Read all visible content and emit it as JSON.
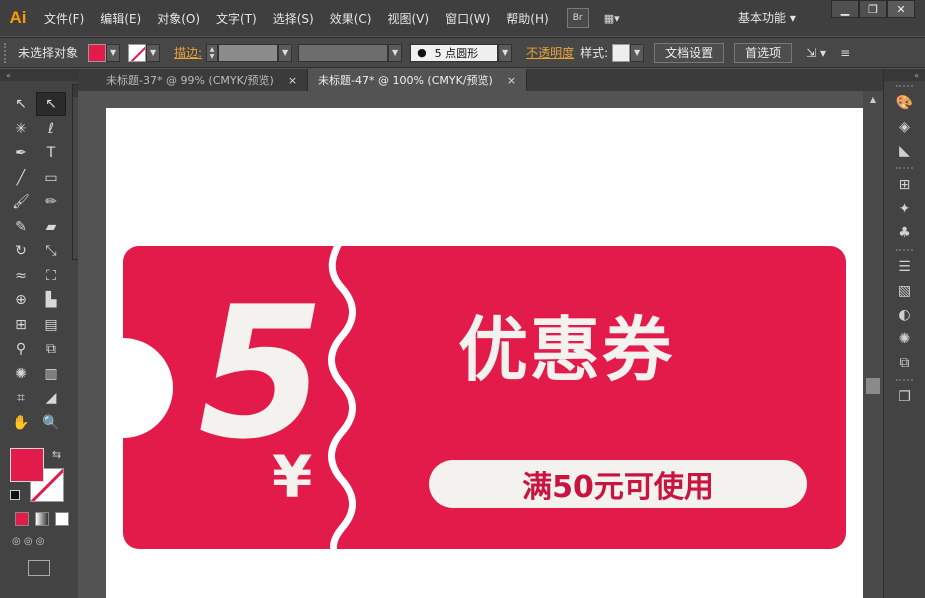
{
  "app": {
    "logo_text": "Ai",
    "menu": [
      "文件(F)",
      "编辑(E)",
      "对象(O)",
      "文字(T)",
      "选择(S)",
      "效果(C)",
      "视图(V)",
      "窗口(W)",
      "帮助(H)"
    ],
    "bridge_button": "Br",
    "workspace_label": "基本功能",
    "window_minimize": "▁",
    "window_restore": "❐",
    "window_close": "✕"
  },
  "control_bar": {
    "selection_text": "未选择对象",
    "stroke_label": "描边:",
    "brush_label": "5 点圆形",
    "opacity_label": "不透明度",
    "style_label": "样式:",
    "doc_setup_button": "文档设置",
    "prefs_button": "首选项",
    "fill_color": "#e31b4a"
  },
  "tabs": [
    {
      "label": "未标题-37* @ 99% (CMYK/预览)",
      "close": "×",
      "active": false
    },
    {
      "label": "未标题-47* @ 100% (CMYK/预览)",
      "close": "×",
      "active": true
    }
  ],
  "artwork": {
    "big_number": "5",
    "currency": "¥",
    "title": "优惠券",
    "condition": "满50元可使用",
    "coupon_color": "#e31b4a",
    "text_color": "#f4f2ee"
  },
  "tools_panel": {
    "fill_color": "#e31b4a",
    "stroke_color": "#ffffff"
  }
}
